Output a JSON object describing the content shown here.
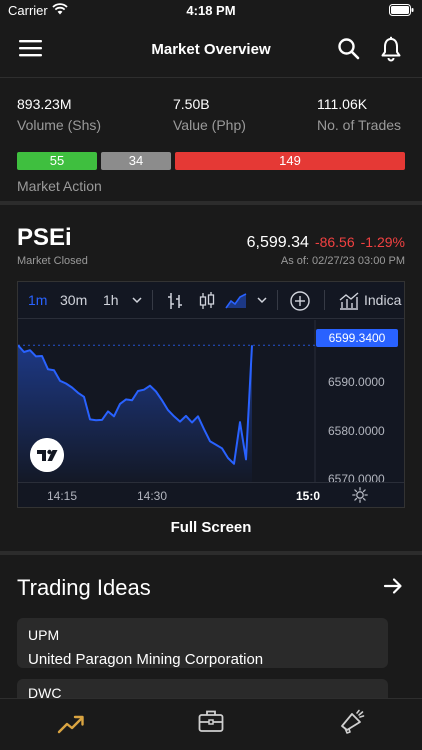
{
  "status_bar": {
    "carrier": "Carrier",
    "time": "4:18 PM"
  },
  "nav": {
    "title": "Market Overview"
  },
  "stats": [
    {
      "value": "893.23M",
      "label": "Volume (Shs)"
    },
    {
      "value": "7.50B",
      "label": "Value (Php)"
    },
    {
      "value": "111.06K",
      "label": "No. of Trades"
    }
  ],
  "market_action": {
    "label": "Market Action",
    "advances": "55",
    "unchanged": "34",
    "declines": "149",
    "colors": {
      "advances": "#3fbf3f",
      "unchanged": "#8c8c8c",
      "declines": "#e53935"
    }
  },
  "index": {
    "name": "PSEi",
    "status": "Market Closed",
    "price": "6,599.34",
    "change": "-86.56",
    "change_pct": "-1.29%",
    "as_of": "As of: 02/27/23 03:00 PM"
  },
  "chart_toolbar": {
    "timeframes": [
      "1m",
      "30m",
      "1h"
    ],
    "active_timeframe": "1m",
    "indicators_label": "Indica"
  },
  "chart_data": {
    "type": "line",
    "y_ticks": [
      "6590.0000",
      "6580.0000",
      "6570.0000"
    ],
    "ylim": [
      6568.5,
      6605
    ],
    "x_ticks": [
      "14:15",
      "14:30",
      "15:0"
    ],
    "last_value_label": "6599.3400",
    "series": [
      {
        "values": [
          6599.3,
          6597.8,
          6598.2,
          6596.8,
          6596.9,
          6593.9,
          6593.7,
          6591.3,
          6590.7,
          6589.8,
          6588.6,
          6587.7,
          6582.6,
          6582.4,
          6582.5,
          6584.4,
          6583.3,
          6586.1,
          6587.1,
          6586.9,
          6589.0,
          6589.3,
          6590.2,
          6588.9,
          6586.9,
          6584.7,
          6583.3,
          6582.1,
          6583.4,
          6581.9,
          6583.3,
          6580.4,
          6577.7,
          6576.9,
          6576.1,
          6573.9,
          6572.6,
          6582.0,
          6573.6,
          6599.3
        ]
      }
    ],
    "line_color": "#2962ff"
  },
  "full_screen_label": "Full Screen",
  "trading_ideas": {
    "title": "Trading Ideas",
    "items": [
      {
        "symbol": "UPM",
        "name": "United Paragon Mining Corporation"
      },
      {
        "symbol": "DWC",
        "name": ""
      }
    ]
  },
  "tabbar": {
    "icons": [
      "trending-up-icon",
      "briefcase-icon",
      "megaphone-icon"
    ],
    "active_color": "#d9a441"
  }
}
